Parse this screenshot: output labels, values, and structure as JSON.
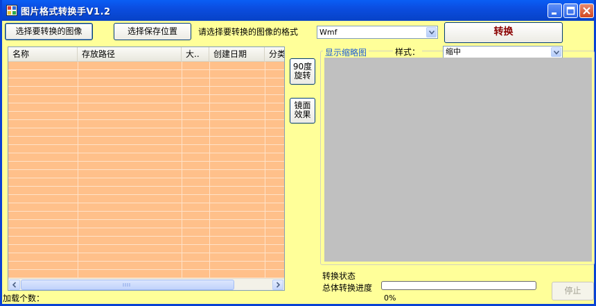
{
  "window": {
    "title": "图片格式转换手V1.2"
  },
  "toolbar": {
    "select_image_label": "选择要转换的图像",
    "select_save_label": "选择保存位置",
    "format_prompt": "请选择要转换的图像的格式",
    "format_value": "Wmf",
    "convert_label": "转换"
  },
  "file_list": {
    "columns": [
      "名称",
      "存放路径",
      "大..",
      "创建日期",
      "分类"
    ]
  },
  "side_buttons": {
    "rotate_label_1": "90度",
    "rotate_label_2": "旋转",
    "mirror_label_1": "镜面",
    "mirror_label_2": "效果"
  },
  "preview": {
    "group_title": "显示缩略图",
    "style_label": "样式：",
    "style_value": "缩中"
  },
  "status": {
    "state_label": "转换状态",
    "progress_label": "总体转换进度",
    "progress_percent": "0%",
    "progress_value": 0,
    "stop_label": "停止",
    "load_count_label": "加载个数："
  },
  "colors": {
    "title_bar": "#0b4de0",
    "window_bg": "#ffff99",
    "list_bg": "#ffc08a",
    "preview_bg": "#c0c0c0",
    "convert_text": "#8b0000",
    "group_title": "#1a5bd6"
  }
}
